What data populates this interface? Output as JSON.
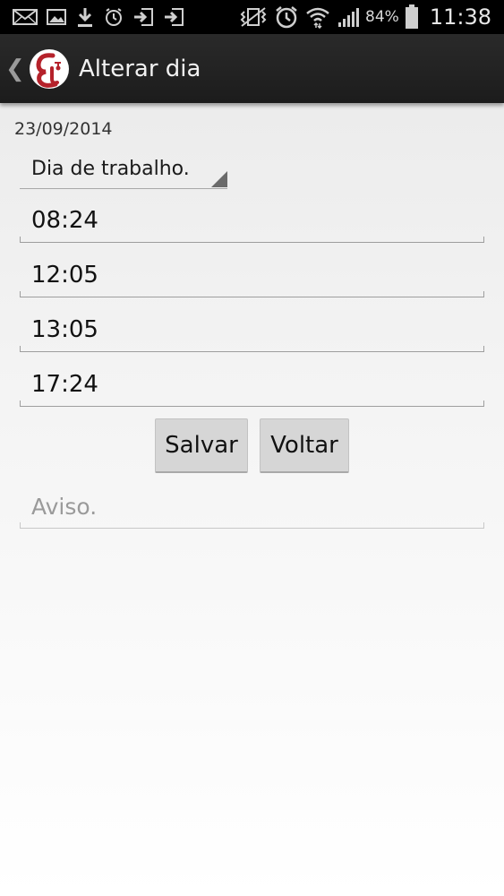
{
  "status_bar": {
    "left_icons": [
      "email-icon",
      "image-icon",
      "download-icon",
      "alarm-icon",
      "sign-in-icon",
      "sign-in-icon"
    ],
    "right_icons": [
      "vibrate-icon",
      "alarm-clock-icon",
      "wifi-icon",
      "signal-icon",
      "battery-icon"
    ],
    "battery_percent": "84%",
    "time": "11:38"
  },
  "action_bar": {
    "title": "Alterar dia"
  },
  "form": {
    "date": "23/09/2014",
    "day_type": "Dia de trabalho.",
    "times": [
      "08:24",
      "12:05",
      "13:05",
      "17:24"
    ],
    "save_label": "Salvar",
    "back_label": "Voltar",
    "notice_placeholder": "Aviso."
  },
  "colors": {
    "action_bar_bg": "#1f1f1f",
    "logo_red": "#b5222b",
    "button_bg": "#d6d6d6"
  }
}
